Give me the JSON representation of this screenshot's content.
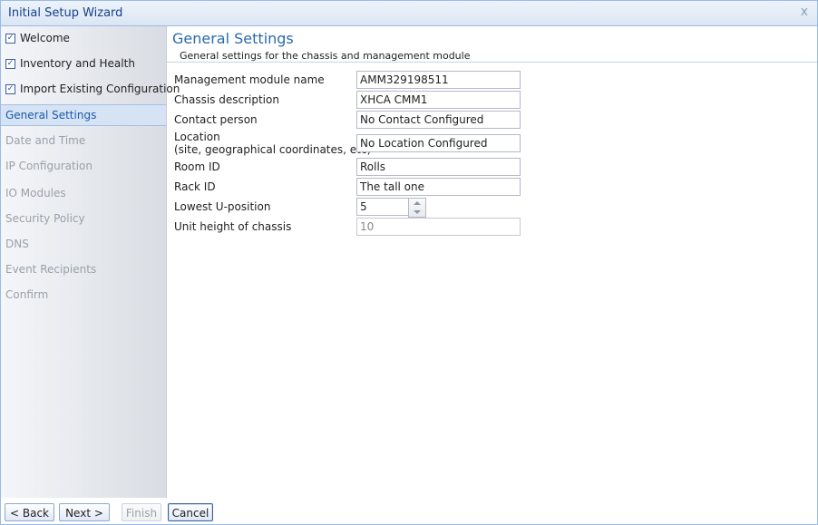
{
  "window": {
    "title": "Initial Setup Wizard",
    "close_glyph": "x"
  },
  "sidebar": {
    "items": [
      {
        "label": "Welcome",
        "state": "checked"
      },
      {
        "label": "Inventory and Health",
        "state": "checked"
      },
      {
        "label": "Import Existing Configuration",
        "state": "checked"
      },
      {
        "label": "General Settings",
        "state": "current"
      },
      {
        "label": "Date and Time",
        "state": "disabled"
      },
      {
        "label": "IP Configuration",
        "state": "disabled"
      },
      {
        "label": "IO Modules",
        "state": "disabled"
      },
      {
        "label": "Security Policy",
        "state": "disabled"
      },
      {
        "label": "DNS",
        "state": "disabled"
      },
      {
        "label": "Event Recipients",
        "state": "disabled"
      },
      {
        "label": "Confirm",
        "state": "disabled"
      }
    ],
    "check_glyph": "✓"
  },
  "header": {
    "title": "General Settings",
    "subtitle": "General settings for the chassis and management module"
  },
  "form": {
    "module_name": {
      "label": "Management module name",
      "value": "AMM329198511"
    },
    "chassis_description": {
      "label": "Chassis description",
      "value": "XHCA CMM1"
    },
    "contact_person": {
      "label": "Contact person",
      "value": "No Contact Configured"
    },
    "location": {
      "label_line1": "Location",
      "label_line2": "(site, geographical coordinates, etc)",
      "value": "No Location Configured"
    },
    "room_id": {
      "label": "Room ID",
      "value": "Rolls"
    },
    "rack_id": {
      "label": "Rack ID",
      "value": "The tall one"
    },
    "lowest_u_position": {
      "label": "Lowest U-position",
      "value": "5"
    },
    "unit_height": {
      "label": "Unit height of chassis",
      "value": "10"
    }
  },
  "footer": {
    "back_label": "< Back",
    "next_label": "Next >",
    "finish_label": "Finish",
    "cancel_label": "Cancel"
  },
  "colors": {
    "accent": "#2b6aab",
    "current_item_bg": "#d5e3f5",
    "disabled_text": "#9aa1aa",
    "border": "#99bbe8"
  }
}
